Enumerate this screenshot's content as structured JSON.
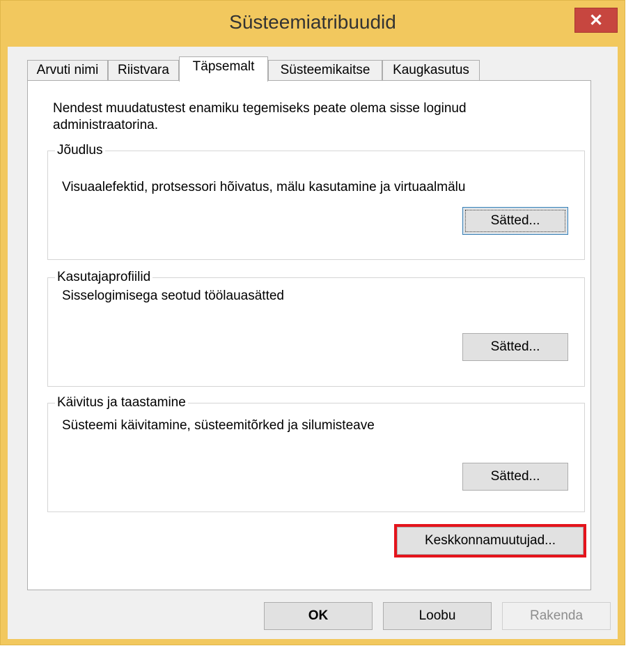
{
  "window": {
    "title": "Süsteemiatribuudid",
    "close_glyph": "✕"
  },
  "tabs": [
    {
      "label": "Arvuti nimi",
      "active": false
    },
    {
      "label": "Riistvara",
      "active": false
    },
    {
      "label": "Täpsemalt",
      "active": true
    },
    {
      "label": "Süsteemikaitse",
      "active": false
    },
    {
      "label": "Kaugkasutus",
      "active": false
    }
  ],
  "intro": "Nendest muudatustest enamiku tegemiseks peate olema sisse loginud administraatorina.",
  "groups": [
    {
      "title": "Jõudlus",
      "description": "Visuaalefektid, protsessori hõivatus, mälu kasutamine ja virtuaalmälu",
      "button": "Sätted..."
    },
    {
      "title": "Kasutajaprofiilid",
      "description": "Sisselogimisega seotud töölauasätted",
      "button": "Sätted..."
    },
    {
      "title": "Käivitus ja taastamine",
      "description": "Süsteemi käivitamine, süsteemitõrked ja silumisteave",
      "button": "Sätted..."
    }
  ],
  "env_button": "Keskkonnamuutujad...",
  "footer": {
    "ok": "OK",
    "cancel": "Loobu",
    "apply": "Rakenda"
  },
  "colors": {
    "frame": "#f2c85e",
    "close_button": "#c7463f",
    "highlight": "#e4141c"
  }
}
